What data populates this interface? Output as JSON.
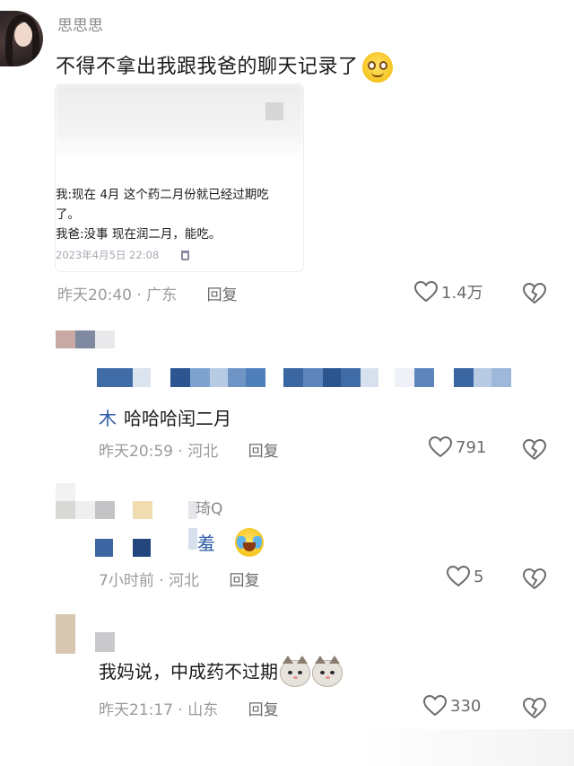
{
  "post": {
    "author": "思思思",
    "text": "不得不拿出我跟我爸的聊天记录了",
    "emoji": "smiling-face-emoji",
    "screenshot": {
      "line1": "我:现在 4月 这个药二月份就已经过期吃",
      "line2": "了。",
      "line3": "我爸:没事 现在润二月，能吃。",
      "timestamp": "2023年4月5日 22:08"
    },
    "time": "昨天20:40",
    "location": "广东",
    "reply_label": "回复",
    "likes": "1.4万"
  },
  "comments": [
    {
      "mention": "木",
      "text": "哈哈哈闰二月",
      "time": "昨天20:59",
      "location": "河北",
      "reply_label": "回复",
      "likes": "791"
    },
    {
      "name_fragment": "琦Q",
      "text_fragment": "羞",
      "time": "7小时前",
      "location": "河北",
      "reply_label": "回复",
      "likes": "5"
    },
    {
      "text": "我妈说，中成药不过期",
      "time": "昨天21:17",
      "location": "山东",
      "reply_label": "回复",
      "likes": "330"
    }
  ],
  "separator": "·",
  "colors": {
    "mention_blue": "#2d5aa8",
    "meta_gray": "#9a9a9a",
    "text": "#1a1a1a"
  }
}
